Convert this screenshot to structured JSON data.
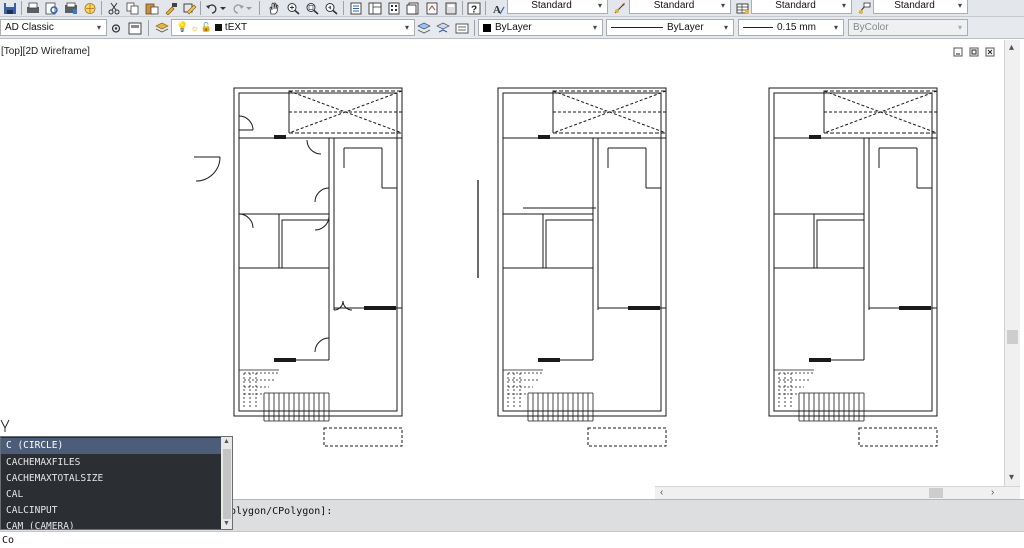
{
  "toolbar_row1": {
    "text_style_combo": "Standard",
    "dim_style_combo": "Standard",
    "table_style_combo": "Standard",
    "mleader_style_combo": "Standard"
  },
  "toolbar_row2": {
    "workspace_combo": "AD Classic",
    "layer_combo": "tEXT",
    "color_combo": "ByLayer",
    "linetype_combo": "ByLayer",
    "lineweight_combo": "0.15 mm",
    "plotstyle_combo": "ByColor"
  },
  "viewport": {
    "label": "[Top][2D Wireframe]"
  },
  "command": {
    "history_text": "olygon/CPolygon]:",
    "input_text": "Co"
  },
  "autocomplete": {
    "items": [
      "C (CIRCLE)",
      "CACHEMAXFILES",
      "CACHEMAXTOTALSIZE",
      "CAL",
      "CALCINPUT",
      "CAM (CAMERA)"
    ]
  },
  "colors": {
    "selected_item": "#4b5d78",
    "list_bg": "#2b2e33",
    "toolbar_bg": "#e3e6ea"
  },
  "icons": [
    "save-icon",
    "print-icon",
    "print-preview-icon",
    "publish-icon",
    "3d-dwf-icon",
    "cut-icon",
    "copy-icon",
    "paste-icon",
    "match-properties-icon",
    "block-editor-icon",
    "undo-icon",
    "redo-icon",
    "pan-icon",
    "zoom-realtime-icon",
    "zoom-window-icon",
    "zoom-previous-icon",
    "properties-icon",
    "design-center-icon",
    "tool-palettes-icon",
    "sheet-set-icon",
    "markup-icon",
    "calculator-icon",
    "help-icon"
  ]
}
